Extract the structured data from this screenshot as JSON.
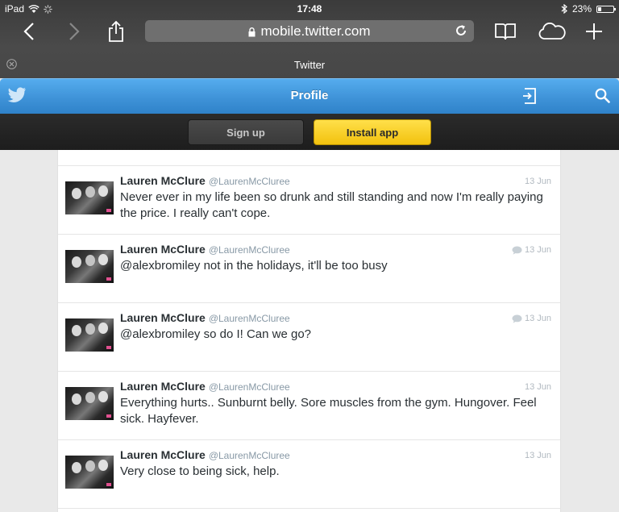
{
  "status_bar": {
    "device": "iPad",
    "time": "17:48",
    "battery": "23%",
    "battery_level": 0.23
  },
  "browser": {
    "url": "mobile.twitter.com",
    "tab_title": "Twitter"
  },
  "twitter": {
    "header_title": "Profile",
    "signup_label": "Sign up",
    "install_label": "Install app",
    "brand_color": "#55acee"
  },
  "tweets": [
    {
      "name": "Lauren McClure",
      "handle": "@LaurenMcCluree",
      "date": "13 Jun",
      "is_reply": false,
      "text": "Never ever in my life been so drunk and still standing and now I'm really paying the price. I really can't cope."
    },
    {
      "name": "Lauren McClure",
      "handle": "@LaurenMcCluree",
      "date": "13 Jun",
      "is_reply": true,
      "text": "@alexbromiley not in the holidays, it'll be too busy"
    },
    {
      "name": "Lauren McClure",
      "handle": "@LaurenMcCluree",
      "date": "13 Jun",
      "is_reply": true,
      "text": "@alexbromiley so do I! Can we go?"
    },
    {
      "name": "Lauren McClure",
      "handle": "@LaurenMcCluree",
      "date": "13 Jun",
      "is_reply": false,
      "text": "Everything hurts.. Sunburnt belly. Sore muscles from the gym. Hungover. Feel sick. Hayfever."
    },
    {
      "name": "Lauren McClure",
      "handle": "@LaurenMcCluree",
      "date": "13 Jun",
      "is_reply": false,
      "text": "Very close to being sick, help."
    }
  ]
}
